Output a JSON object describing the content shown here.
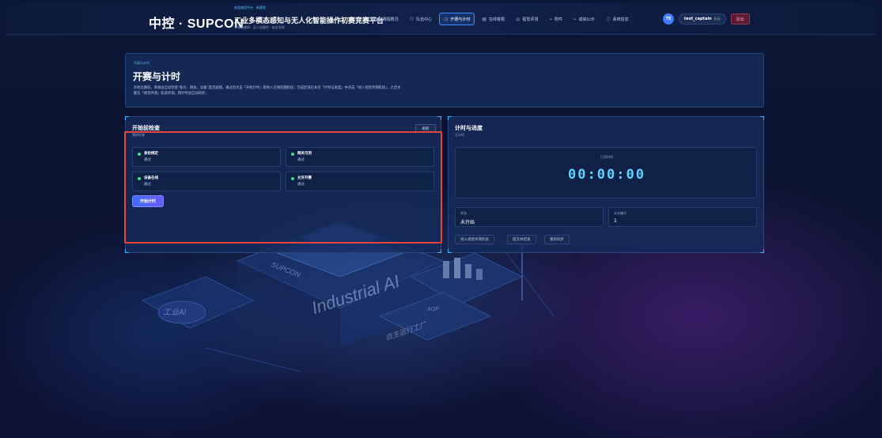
{
  "header": {
    "brand_top": "欢迎使用平台 · 新赛程",
    "brand_logo": "中控 · SUPCON",
    "title": "工业多模态感知与无人化智能操作初赛竞赛平台",
    "subtitle": "多模态感知 · 无人化操作 · 安全合规",
    "nav": [
      {
        "label": "赛程概况",
        "icon": "▦"
      },
      {
        "label": "队伍中心",
        "icon": "⚇"
      },
      {
        "label": "开赛与计时",
        "icon": "◷"
      },
      {
        "label": "在线答题",
        "icon": "▤"
      },
      {
        "label": "视觉评测",
        "icon": "◎"
      },
      {
        "label": "附件",
        "icon": "⌁"
      },
      {
        "label": "成绩公示",
        "icon": "⌁"
      },
      {
        "label": "系统信息",
        "icon": "ⓘ"
      }
    ],
    "user": {
      "initials": "TE",
      "name": "test_captain",
      "role": "队长"
    },
    "logout": "退出"
  },
  "hero": {
    "tag": "开赛与计时",
    "title": "开赛与计时",
    "desc": "开始比赛前，系统会自动检查“账号、网关、设备”是否就绪。通过后点击「开始计时」即进入在线答题阶段；完成后须在本页「计时与进度」中点击「进入视觉评测阶段」，之后才能在「视觉评测」轨道评测。倒计时会自动同步。"
  },
  "precheck": {
    "title": "开始前检查",
    "subtitle": "需前检查",
    "refresh": "刷新",
    "items": [
      {
        "name": "身份绑定",
        "status": "通过"
      },
      {
        "name": "网关可用",
        "status": "通过"
      },
      {
        "name": "设备在线",
        "status": "通过"
      },
      {
        "name": "允许开赛",
        "status": "通过"
      }
    ],
    "start_button": "开始计时"
  },
  "timer": {
    "title": "计时与进度",
    "subtitle": "正计时",
    "label": "已用时间",
    "value": "00:00:00",
    "status_label": "状态",
    "status_value": "未开始",
    "round_label": "本次编号",
    "round_value": "1",
    "actions": [
      "进入视觉评测阶段",
      "提交并结束",
      "重新同步"
    ]
  },
  "background": {
    "text_industrial": "Industrial AI",
    "text_supcon": "SUPCON",
    "text_iot": "工业AI",
    "text_factory": "自主运行工厂",
    "text_aop": "AOP"
  },
  "colors": {
    "accent": "#3f8cff",
    "timer": "#5fd3ff",
    "pass": "#3fe08a",
    "highlight": "#e8443e"
  }
}
